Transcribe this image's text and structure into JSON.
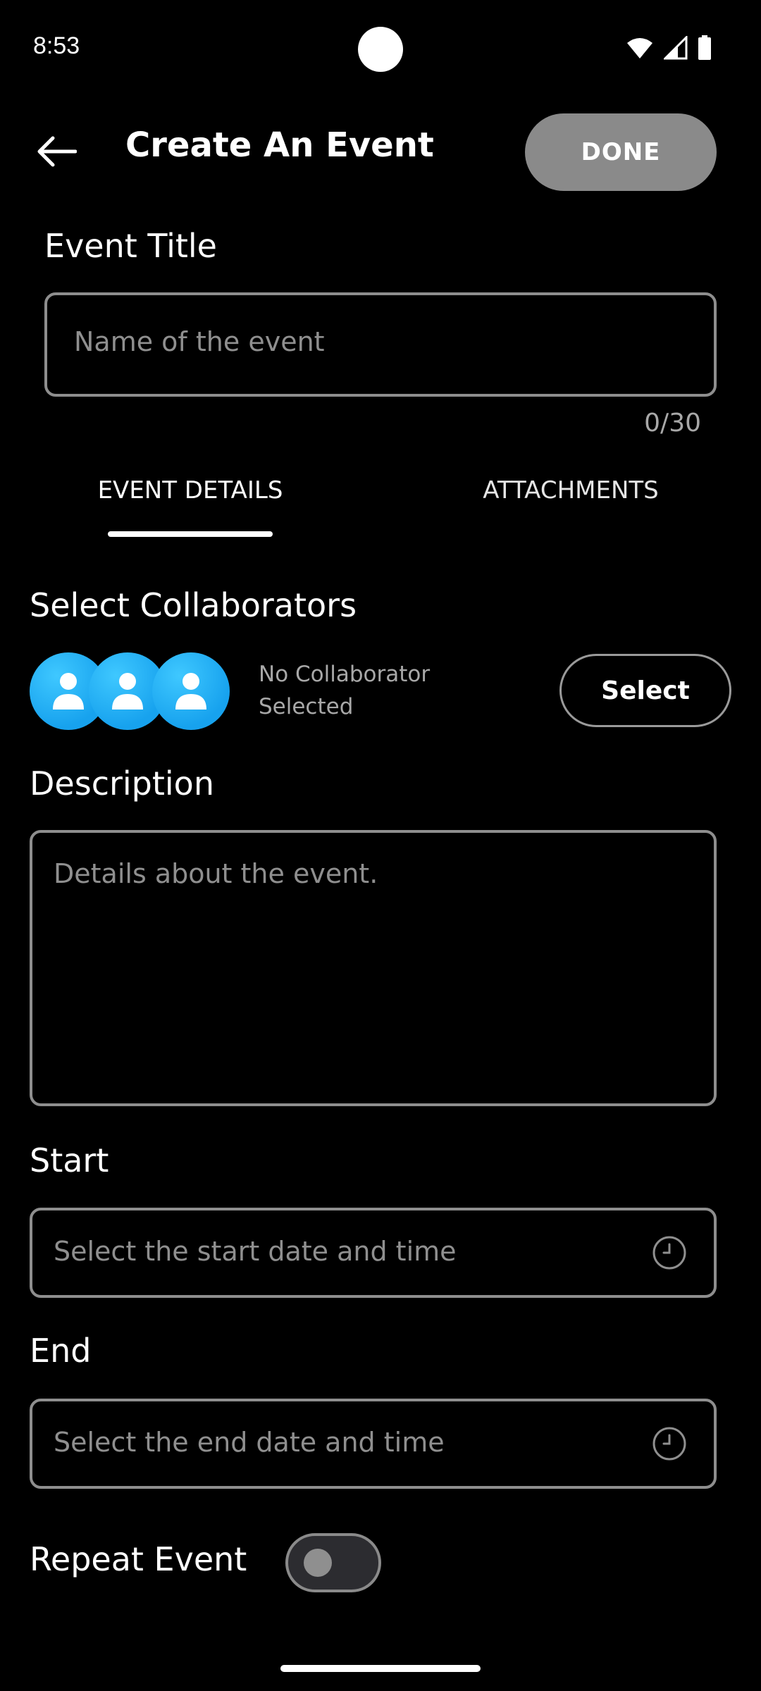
{
  "status_bar": {
    "time": "8:53",
    "icons": [
      "wifi-icon",
      "signal-icon",
      "battery-icon"
    ]
  },
  "header": {
    "title": "Create An Event",
    "back_icon": "arrow-left-icon",
    "done_label": "DONE"
  },
  "event_title": {
    "label": "Event Title",
    "placeholder": "Name of the event",
    "value": "",
    "counter": "0/30"
  },
  "tabs": [
    {
      "label": "EVENT DETAILS",
      "active": true
    },
    {
      "label": "ATTACHMENTS",
      "active": false
    }
  ],
  "collaborators": {
    "label": "Select Collaborators",
    "status_line1": "No Collaborator",
    "status_line2": "Selected",
    "select_label": "Select",
    "avatar_icon": "user-icon"
  },
  "description": {
    "label": "Description",
    "placeholder": "Details about the event."
  },
  "start": {
    "label": "Start",
    "placeholder": "Select the start date and time",
    "icon": "clock-icon"
  },
  "end": {
    "label": "End",
    "placeholder": "Select the end date and time",
    "icon": "clock-icon"
  },
  "repeat": {
    "label": "Repeat Event",
    "enabled": false
  },
  "colors": {
    "background": "#000000",
    "done_button": "#8a8a8a",
    "avatar_blue": "#1aa7f0",
    "outline": "#8e8e8e",
    "placeholder_text": "#8f8f8f"
  }
}
